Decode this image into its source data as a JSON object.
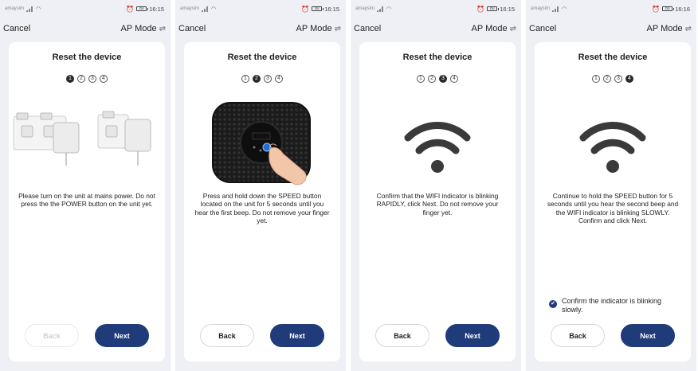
{
  "screens": [
    {
      "status": {
        "carrier": "amaysim",
        "time": "16:15",
        "battery": "80"
      },
      "cancel": "Cancel",
      "mode": "AP Mode",
      "title": "Reset the device",
      "steps": [
        "1",
        "2",
        "3",
        "4"
      ],
      "active_step": 1,
      "description": "Please turn on the unit at mains power. Do not press the the POWER button on the unit yet.",
      "back": "Back",
      "back_enabled": false,
      "next": "Next"
    },
    {
      "status": {
        "carrier": "amaysim",
        "time": "16:15",
        "battery": "80"
      },
      "cancel": "Cancel",
      "mode": "AP Mode",
      "title": "Reset the device",
      "steps": [
        "1",
        "2",
        "3",
        "4"
      ],
      "active_step": 2,
      "description": "Press and hold down the SPEED button located on the unit for 5 seconds until you hear the first beep. Do not remove your finger yet.",
      "back": "Back",
      "back_enabled": true,
      "next": "Next"
    },
    {
      "status": {
        "carrier": "amaysim",
        "time": "16:15",
        "battery": "80"
      },
      "cancel": "Cancel",
      "mode": "AP Mode",
      "title": "Reset the device",
      "steps": [
        "1",
        "2",
        "3",
        "4"
      ],
      "active_step": 3,
      "description": "Confirm that the WIFI indicator is blinking RAPIDLY, click Next. Do not remove your finger yet.",
      "back": "Back",
      "back_enabled": true,
      "next": "Next"
    },
    {
      "status": {
        "carrier": "amaysim",
        "time": "16:16",
        "battery": "80"
      },
      "cancel": "Cancel",
      "mode": "AP Mode",
      "title": "Reset the device",
      "steps": [
        "1",
        "2",
        "3",
        "4"
      ],
      "active_step": 4,
      "description": "Continue to hold the SPEED button for 5 seconds until you hear the second beep and the WIFI indicator is blinking SLOWLY. Confirm and click Next.",
      "confirm_label": "Confirm the indicator is blinking slowly.",
      "back": "Back",
      "back_enabled": true,
      "next": "Next"
    }
  ],
  "colors": {
    "primary": "#1f3b7a",
    "background": "#eef0f5",
    "card": "#ffffff"
  }
}
